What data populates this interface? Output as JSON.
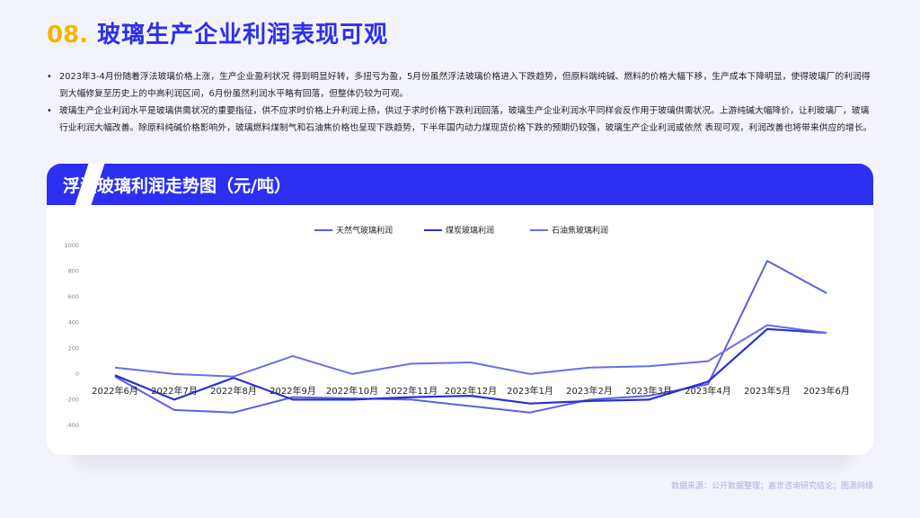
{
  "header": {
    "number": "08.",
    "title": "玻璃生产企业利润表现可观"
  },
  "bullets": [
    "2023年3-4月份随着浮法玻璃价格上涨，生产企业盈利状况 得到明显好转，多扭亏为盈，5月份虽然浮法玻璃价格进入下跌趋势，但原料端纯碱、燃料的价格大幅下移，生产成本下降明显，使得玻璃厂的利润得到大幅修复至历史上的中高利润区间，6月份虽然利润水平略有回落，但整体仍较为可观。",
    "玻璃生产企业利润水平是玻璃供需状况的重要指征，供不应求时价格上升利润上扬，供过于求时价格下跌利润回落，玻璃生产企业利润水平同样会反作用于玻璃供需状况。上游纯碱大幅降价，让利玻璃厂，玻璃行业利润大幅改善。除原料纯碱价格影响外，玻璃燃料煤制气和石油焦价格也呈现下跌趋势，下半年国内动力煤现货价格下跌的预期仍较强，玻璃生产企业利润或依然 表现可观，利润改善也将带来供应的增长。"
  ],
  "bullet_marker": "•",
  "card": {
    "title": "浮法玻璃利润走势图（元/吨）"
  },
  "source": "数据来源：公开数据整理；嘉世咨询研究结论；图源网络",
  "chart_data": {
    "type": "line",
    "categories": [
      "2022年6月",
      "2022年7月",
      "2022年8月",
      "2022年9月",
      "2022年10月",
      "2022年11月",
      "2022年12月",
      "2023年1月",
      "2023年2月",
      "2023年3月",
      "2023年4月",
      "2023年5月",
      "2023年6月"
    ],
    "ylim": [
      -400,
      1000
    ],
    "yticks": [
      1000,
      800,
      600,
      400,
      200,
      0,
      -200,
      -400
    ],
    "series": [
      {
        "name": "天然气玻璃利润",
        "color": "#5b5fe0",
        "values": [
          -20,
          -280,
          -300,
          -180,
          -190,
          -200,
          -250,
          -300,
          -200,
          -170,
          -80,
          880,
          630
        ]
      },
      {
        "name": "煤炭玻璃利润",
        "color": "#2b2fd6",
        "values": [
          -10,
          -200,
          -30,
          -200,
          -200,
          -180,
          -170,
          -230,
          -210,
          -200,
          -60,
          350,
          320
        ]
      },
      {
        "name": "石油焦玻璃利润",
        "color": "#6a6ee6",
        "values": [
          50,
          0,
          -20,
          140,
          0,
          80,
          90,
          0,
          50,
          60,
          100,
          380,
          320
        ]
      }
    ],
    "grid": false,
    "legend": "top"
  }
}
